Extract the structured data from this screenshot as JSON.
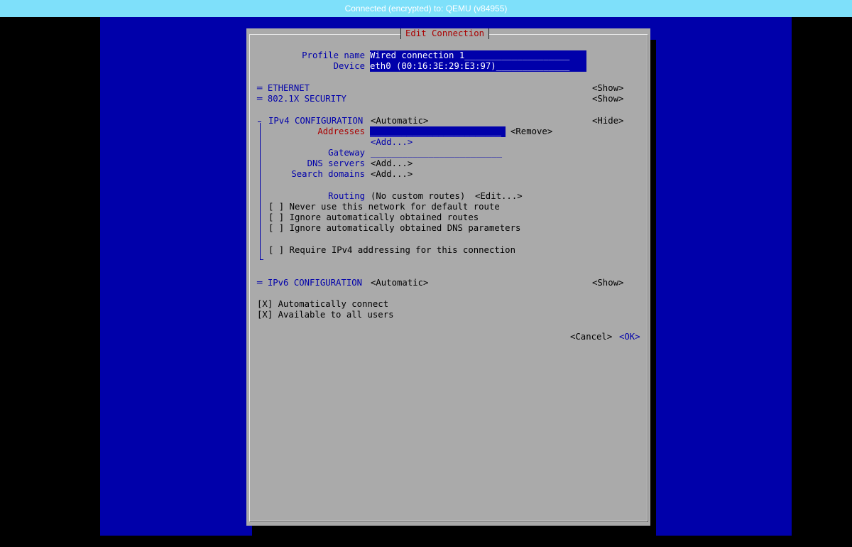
{
  "vnc_bar": {
    "text": "Connected (encrypted) to: QEMU (v84955)"
  },
  "dialog": {
    "title": "Edit Connection",
    "profile_name_label": "Profile name",
    "profile_name_value": "Wired connection 1",
    "device_label": "Device",
    "device_value": "eth0 (00:16:3E:29:E3:97)",
    "ethernet": {
      "label": "ETHERNET",
      "toggle": "<Show>"
    },
    "security": {
      "label": "802.1X SECURITY",
      "toggle": "<Show>"
    },
    "ipv4": {
      "label": "IPv4 CONFIGURATION",
      "method": "<Automatic>",
      "toggle": "<Hide>",
      "addresses_label": "Addresses",
      "addresses_value": "",
      "remove": "<Remove>",
      "add_address": "<Add...>",
      "gateway_label": "Gateway",
      "gateway_value": "",
      "dns_label": "DNS servers",
      "dns_add": "<Add...>",
      "search_label": "Search domains",
      "search_add": "<Add...>",
      "routing_label": "Routing",
      "routing_value": "(No custom routes)",
      "routing_edit": "<Edit...>",
      "checkboxes": [
        {
          "mark": "[ ]",
          "label": "Never use this network for default route"
        },
        {
          "mark": "[ ]",
          "label": "Ignore automatically obtained routes"
        },
        {
          "mark": "[ ]",
          "label": "Ignore automatically obtained DNS parameters"
        },
        {
          "mark": "[ ]",
          "label": "Require IPv4 addressing for this connection"
        }
      ]
    },
    "ipv6": {
      "label": "IPv6 CONFIGURATION",
      "method": "<Automatic>",
      "toggle": "<Show>"
    },
    "auto_connect": {
      "mark": "[X]",
      "label": "Automatically connect"
    },
    "all_users": {
      "mark": "[X]",
      "label": "Available to all users"
    },
    "cancel": "<Cancel>",
    "ok": "<OK>"
  }
}
